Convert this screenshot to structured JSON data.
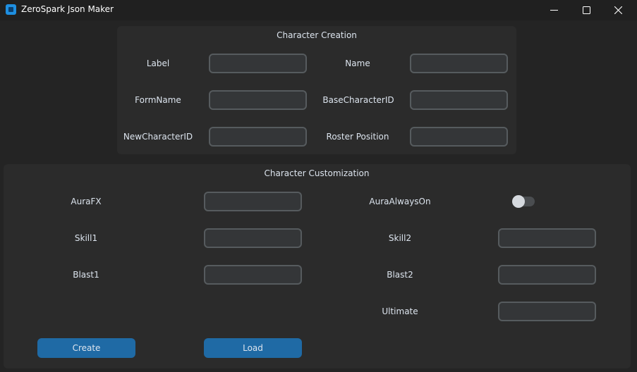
{
  "window": {
    "title": "ZeroSpark Json Maker",
    "accent": "#1f6aa5"
  },
  "creation": {
    "title": "Character Creation",
    "fields": {
      "label": {
        "label": "Label",
        "value": ""
      },
      "name": {
        "label": "Name",
        "value": ""
      },
      "form_name": {
        "label": "FormName",
        "value": ""
      },
      "base_character_id": {
        "label": "BaseCharacterID",
        "value": ""
      },
      "new_character_id": {
        "label": "NewCharacterID",
        "value": ""
      },
      "roster_position": {
        "label": "Roster Position",
        "value": ""
      }
    }
  },
  "customization": {
    "title": "Character Customization",
    "fields": {
      "aura_fx": {
        "label": "AuraFX",
        "value": ""
      },
      "aura_always_on": {
        "label": "AuraAlwaysOn",
        "checked": false
      },
      "skill1": {
        "label": "Skill1",
        "value": ""
      },
      "skill2": {
        "label": "Skill2",
        "value": ""
      },
      "blast1": {
        "label": "Blast1",
        "value": ""
      },
      "blast2": {
        "label": "Blast2",
        "value": ""
      },
      "ultimate": {
        "label": "Ultimate",
        "value": ""
      }
    }
  },
  "actions": {
    "create_label": "Create",
    "load_label": "Load"
  }
}
